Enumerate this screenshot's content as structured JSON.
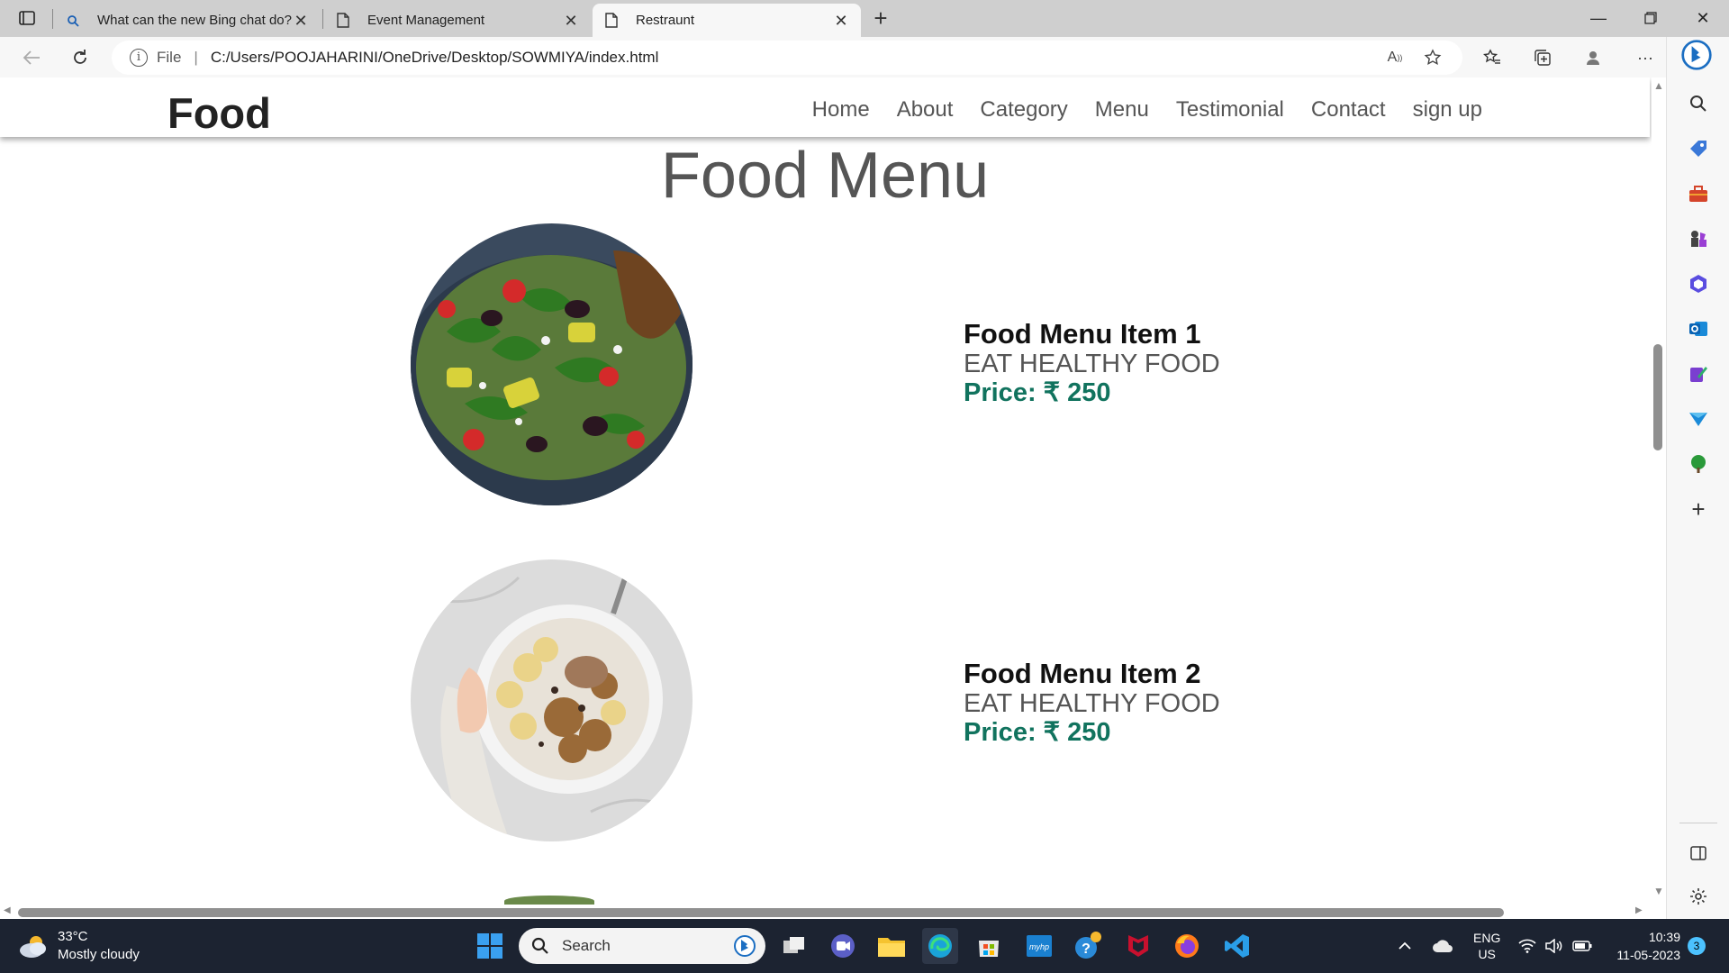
{
  "browser": {
    "tabs": [
      {
        "title": "What can the new Bing chat do?",
        "icon": "search-icon"
      },
      {
        "title": "Event Management",
        "icon": "page-icon"
      },
      {
        "title": "Restraunt",
        "icon": "page-icon"
      }
    ],
    "address": {
      "scheme_label": "File",
      "url": "C:/Users/POOJAHARINI/OneDrive/Desktop/SOWMIYA/index.html"
    }
  },
  "site": {
    "logo": "Food",
    "nav": [
      "Home",
      "About",
      "Category",
      "Menu",
      "Testimonial",
      "Contact",
      "sign up"
    ],
    "section_title": "Food Menu",
    "items": [
      {
        "name": "Food Menu Item 1",
        "desc": "EAT HEALTHY FOOD",
        "price": "Price: ₹ 250"
      },
      {
        "name": "Food Menu Item 2",
        "desc": "EAT HEALTHY FOOD",
        "price": "Price: ₹ 250"
      }
    ],
    "accent_color": "#11735e"
  },
  "taskbar": {
    "weather_temp": "33°C",
    "weather_desc": "Mostly cloudy",
    "search_label": "Search",
    "lang_top": "ENG",
    "lang_bottom": "US",
    "time": "10:39",
    "date": "11-05-2023",
    "notification_count": "3"
  }
}
